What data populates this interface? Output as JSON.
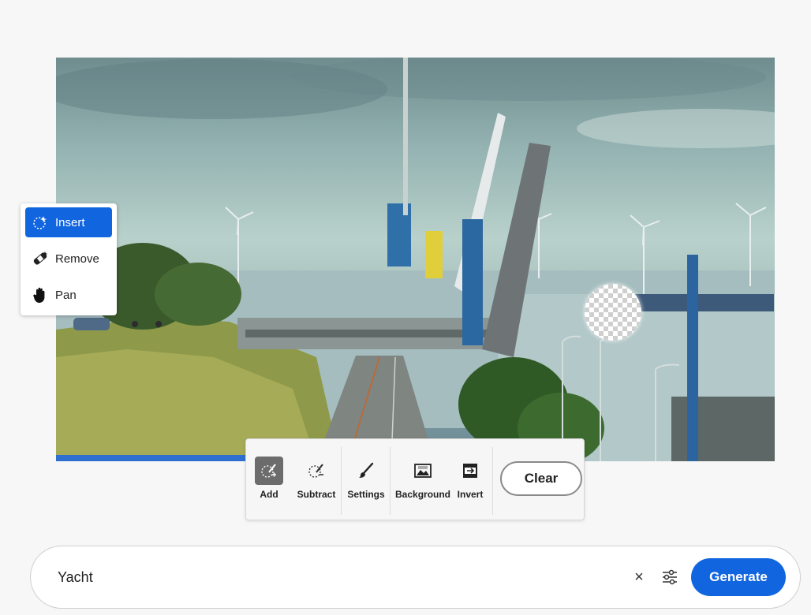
{
  "tool_menu": {
    "items": [
      {
        "label": "Insert",
        "icon": "insert-sparkle-icon",
        "active": true
      },
      {
        "label": "Remove",
        "icon": "remove-bandage-icon",
        "active": false
      },
      {
        "label": "Pan",
        "icon": "hand-icon",
        "active": false
      }
    ]
  },
  "mask_toolbar": {
    "add_label": "Add",
    "subtract_label": "Subtract",
    "settings_label": "Settings",
    "background_label": "Background",
    "invert_label": "Invert",
    "clear_label": "Clear"
  },
  "prompt": {
    "value": "Yacht",
    "clear_symbol": "×",
    "generate_label": "Generate"
  },
  "colors": {
    "accent": "#1166e0",
    "selection": "#2f6fcf"
  }
}
